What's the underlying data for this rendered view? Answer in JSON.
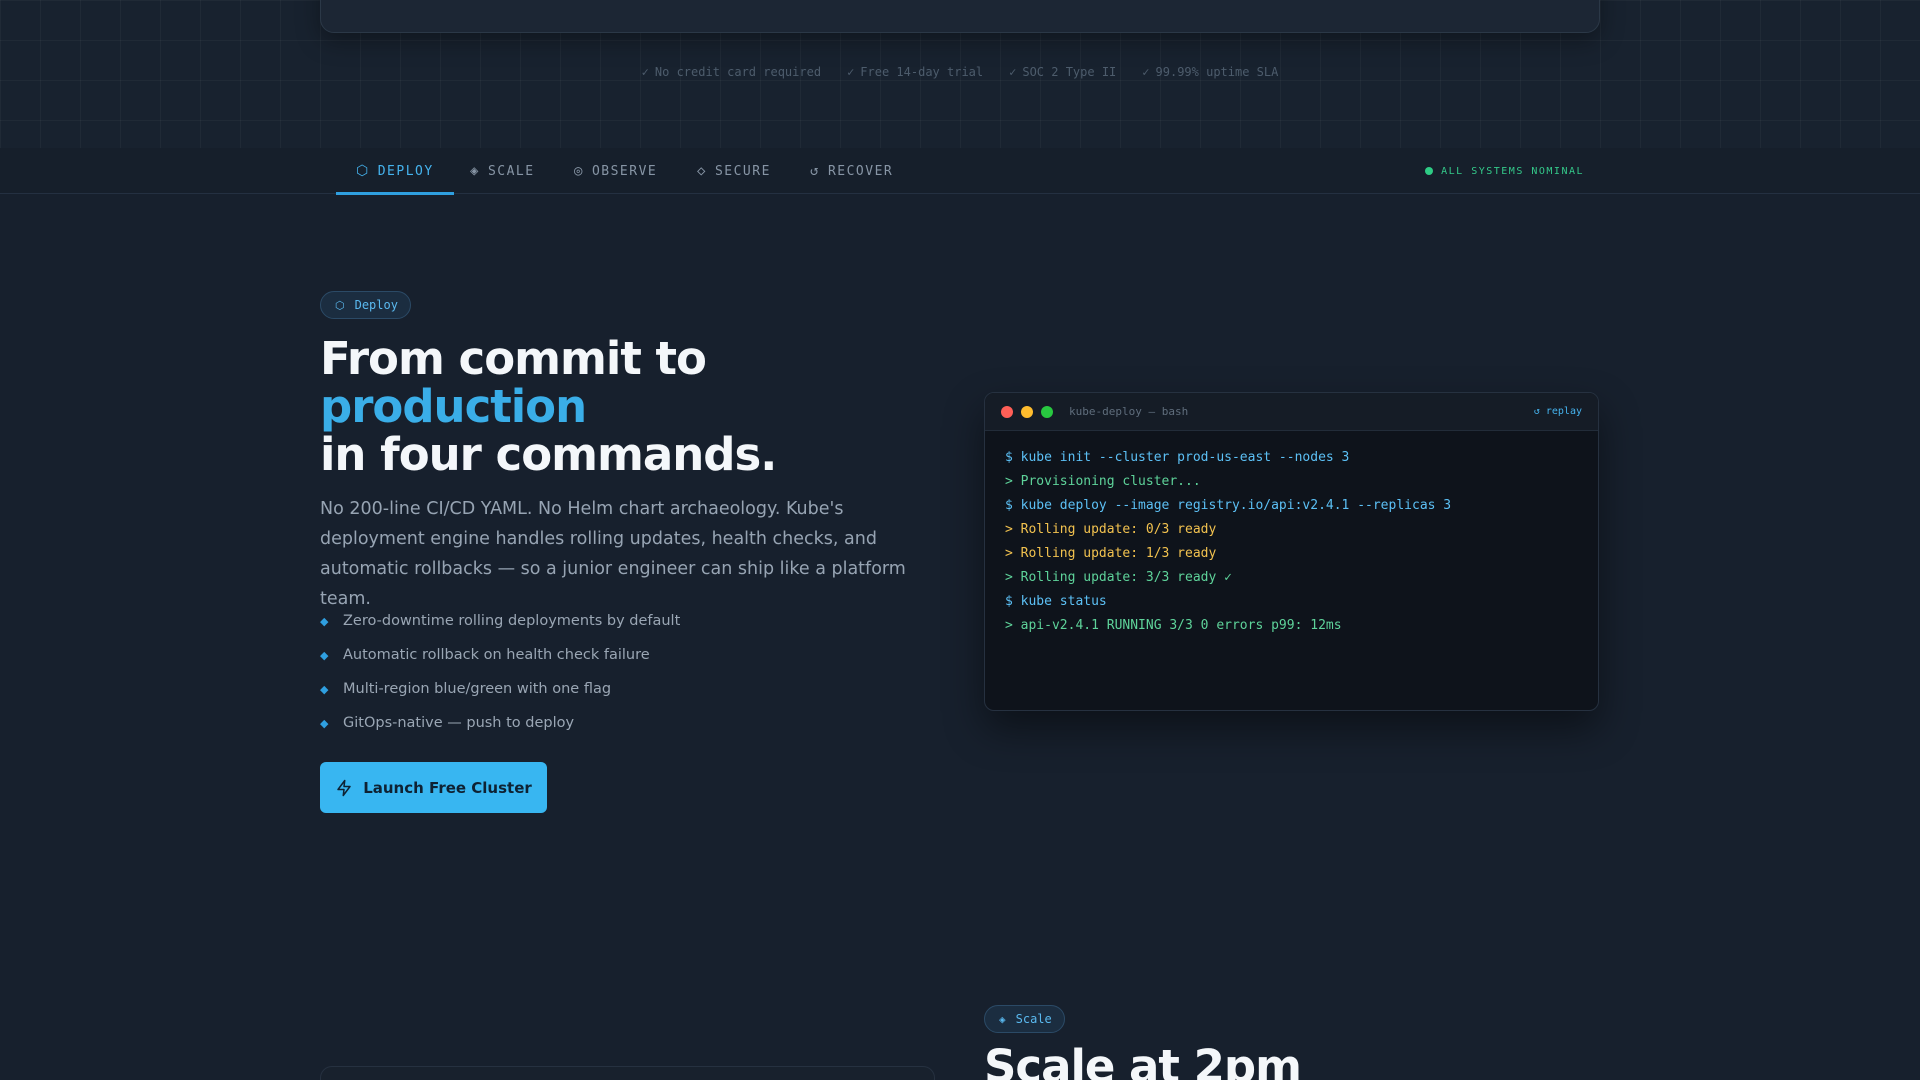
{
  "trust_badges": [
    "No credit card required",
    "Free 14-day trial",
    "SOC 2 Type II",
    "99.99% uptime SLA"
  ],
  "trust_check": "✓",
  "tabs": [
    {
      "label": "DEPLOY",
      "icon": "hexagon-icon",
      "glyph": "⬡"
    },
    {
      "label": "SCALE",
      "icon": "diamond-icon",
      "glyph": "◈"
    },
    {
      "label": "OBSERVE",
      "icon": "target-icon",
      "glyph": "◎"
    },
    {
      "label": "SECURE",
      "icon": "diamond-outline-icon",
      "glyph": "◇"
    },
    {
      "label": "RECOVER",
      "icon": "refresh-icon",
      "glyph": "↺"
    }
  ],
  "active_tab": "DEPLOY",
  "status": {
    "label": "ALL SYSTEMS NOMINAL",
    "color": "#2ecc85"
  },
  "deploy": {
    "pill_label": "Deploy",
    "pill_glyph": "⬡",
    "headline_line1": "From commit to",
    "headline_accent": "production",
    "headline_line3": "in four commands.",
    "lede": "No 200-line CI/CD YAML. No Helm chart archaeology. Kube's deployment engine handles rolling updates, health checks, and automatic rollbacks — so a junior engineer can ship like a platform team.",
    "bullets": [
      "Zero-downtime rolling deployments by default",
      "Automatic rollback on health check failure",
      "Multi-region blue/green with one flag",
      "GitOps-native — push to deploy"
    ],
    "bullet_glyph": "◆",
    "cta_label": "Launch Free Cluster"
  },
  "terminal": {
    "title": "kube-deploy — bash",
    "replay_label": "↺ replay",
    "lines": [
      {
        "type": "cmd",
        "text": "$ kube init --cluster prod-us-east --nodes 3"
      },
      {
        "type": "info",
        "text": "> Provisioning cluster..."
      },
      {
        "type": "cmd",
        "text": "$ kube deploy --image registry.io/api:v2.4.1 --replicas 3"
      },
      {
        "type": "warn",
        "text": "> Rolling update: 0/3 ready"
      },
      {
        "type": "warn",
        "text": "> Rolling update: 1/3 ready"
      },
      {
        "type": "info",
        "text": "> Rolling update: 3/3 ready ✓"
      },
      {
        "type": "cmd",
        "text": "$ kube status"
      },
      {
        "type": "info",
        "text": "> api-v2.4.1 RUNNING 3/3 0 errors p99: 12ms"
      }
    ],
    "traffic_lights": [
      "#ff5f57",
      "#febc2e",
      "#28c840"
    ]
  },
  "scale": {
    "pill_label": "Scale",
    "pill_glyph": "◈",
    "headline": "Scale at 2pm"
  },
  "colors": {
    "accent": "#38b6f1",
    "background": "#17202d"
  }
}
